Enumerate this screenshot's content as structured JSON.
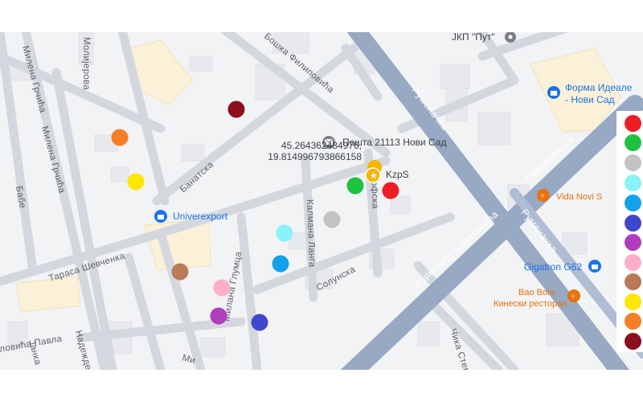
{
  "map": {
    "places": {
      "jkp_put": "ЈКП \"Пут\"",
      "forma_ideale_line1": "Форма Идеале",
      "forma_ideale_line2": "- Нови Сад",
      "posta": "Пошта 21113 Нови Сад",
      "kzps": "KzpS",
      "univerexport": "Univerexport",
      "vida": "Vida Novi S",
      "gigatron": "Gigatron G62",
      "bao_bora": "Bao Bora",
      "bao_bora_sub": "Кинески ресторан"
    },
    "streets": {
      "molierova": "Молијерова",
      "milena_1": "Милена Грчића",
      "milena_2": "Милена Грчића",
      "filipovica": "Бошка Филиповића",
      "banatska": "Банатска",
      "tarasa": "Тараса Шевченка",
      "babe": "Бабе",
      "pavla": "ловића Павла",
      "janka": "Јанка",
      "nadezhde": "Надежде",
      "milana_glumca": "Милана Глумца",
      "kalmana": "Калмана Ланга",
      "krfska": "Крфска",
      "solunska": "Солунска",
      "rumenacka_top": "Руменачка",
      "rumenacka_bottom": "Руменачка",
      "partizanska": "Партизанска",
      "kornelija": "Корнелија Станковића",
      "chika": "Чика Стевина",
      "mi": "Ми"
    },
    "coordinates": {
      "lat": "45.264362484976,",
      "lng": "19.814996793866158"
    }
  },
  "markers": [
    {
      "name": "dark-red-marker",
      "color": "#8b0f1c"
    },
    {
      "name": "orange-marker",
      "color": "#f47f26"
    },
    {
      "name": "yellow-marker",
      "color": "#ffe800"
    },
    {
      "name": "green-marker",
      "color": "#1ec23f"
    },
    {
      "name": "red-marker",
      "color": "#ee1c25"
    },
    {
      "name": "gray-marker",
      "color": "#c3c3c3"
    },
    {
      "name": "light-cyan-marker",
      "color": "#88f4f7"
    },
    {
      "name": "blue-marker",
      "color": "#12a1ea"
    },
    {
      "name": "brown-marker",
      "color": "#b97a57"
    },
    {
      "name": "pink-marker",
      "color": "#ffadc9"
    },
    {
      "name": "purple-marker",
      "color": "#b23dbd"
    },
    {
      "name": "indigo-marker",
      "color": "#3f48cc"
    }
  ],
  "palette": [
    {
      "name": "palette-red",
      "color": "#ee1c25"
    },
    {
      "name": "palette-green",
      "color": "#1ec23f"
    },
    {
      "name": "palette-gray",
      "color": "#c3c3c3"
    },
    {
      "name": "palette-light-cyan",
      "color": "#88f4f7"
    },
    {
      "name": "palette-blue",
      "color": "#12a1ea"
    },
    {
      "name": "palette-indigo",
      "color": "#3f48cc"
    },
    {
      "name": "palette-purple",
      "color": "#b23dbd"
    },
    {
      "name": "palette-pink",
      "color": "#ffadc9"
    },
    {
      "name": "palette-brown",
      "color": "#b97a57"
    },
    {
      "name": "palette-yellow",
      "color": "#ffe800"
    },
    {
      "name": "palette-orange",
      "color": "#f47f26"
    },
    {
      "name": "palette-dark-red",
      "color": "#8b0f1c"
    }
  ],
  "icons": [
    "mail-icon",
    "shopping-bag-icon",
    "poi-icon",
    "star-pin-icon",
    "restaurant-icon"
  ]
}
